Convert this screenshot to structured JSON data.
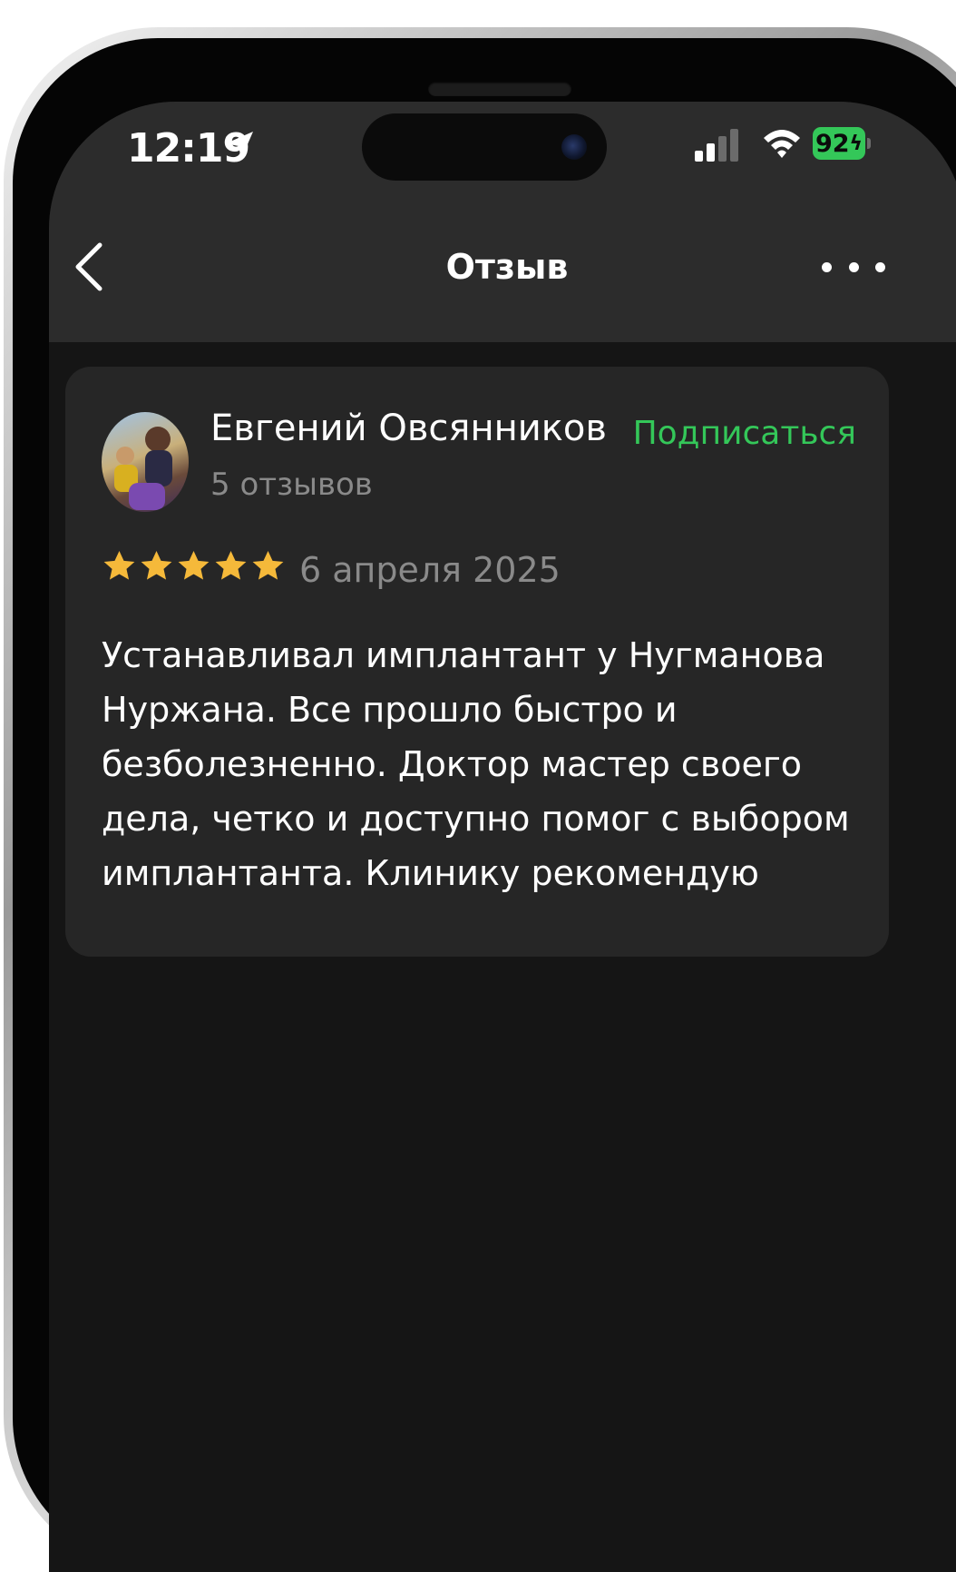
{
  "status_bar": {
    "time": "12:19",
    "battery": "92",
    "icons": [
      "location-arrow-icon",
      "cellular-signal-icon",
      "wifi-icon",
      "battery-charging-icon"
    ]
  },
  "nav": {
    "title": "Отзыв",
    "back_icon": "chevron-left-icon",
    "more_icon": "ellipsis-icon"
  },
  "review": {
    "author_name": "Евгений Овсянников",
    "reviews_count": "5 отзывов",
    "subscribe_label": "Подписаться",
    "rating": 5,
    "rating_max": 5,
    "date": "6 апреля 2025",
    "text": "Устанавливал имплантант у Нугманова Нуржана. Все прошло быстро и безболезненно. Доктор мастер своего дела, четко и доступно помог с выбором имплантанта. Клинику рекомендую"
  },
  "colors": {
    "accent_green": "#34c759",
    "star_yellow": "#f5b93a",
    "background": "#151515",
    "card": "#262626",
    "header": "#2c2c2c",
    "secondary_text": "#8a8a8a"
  }
}
